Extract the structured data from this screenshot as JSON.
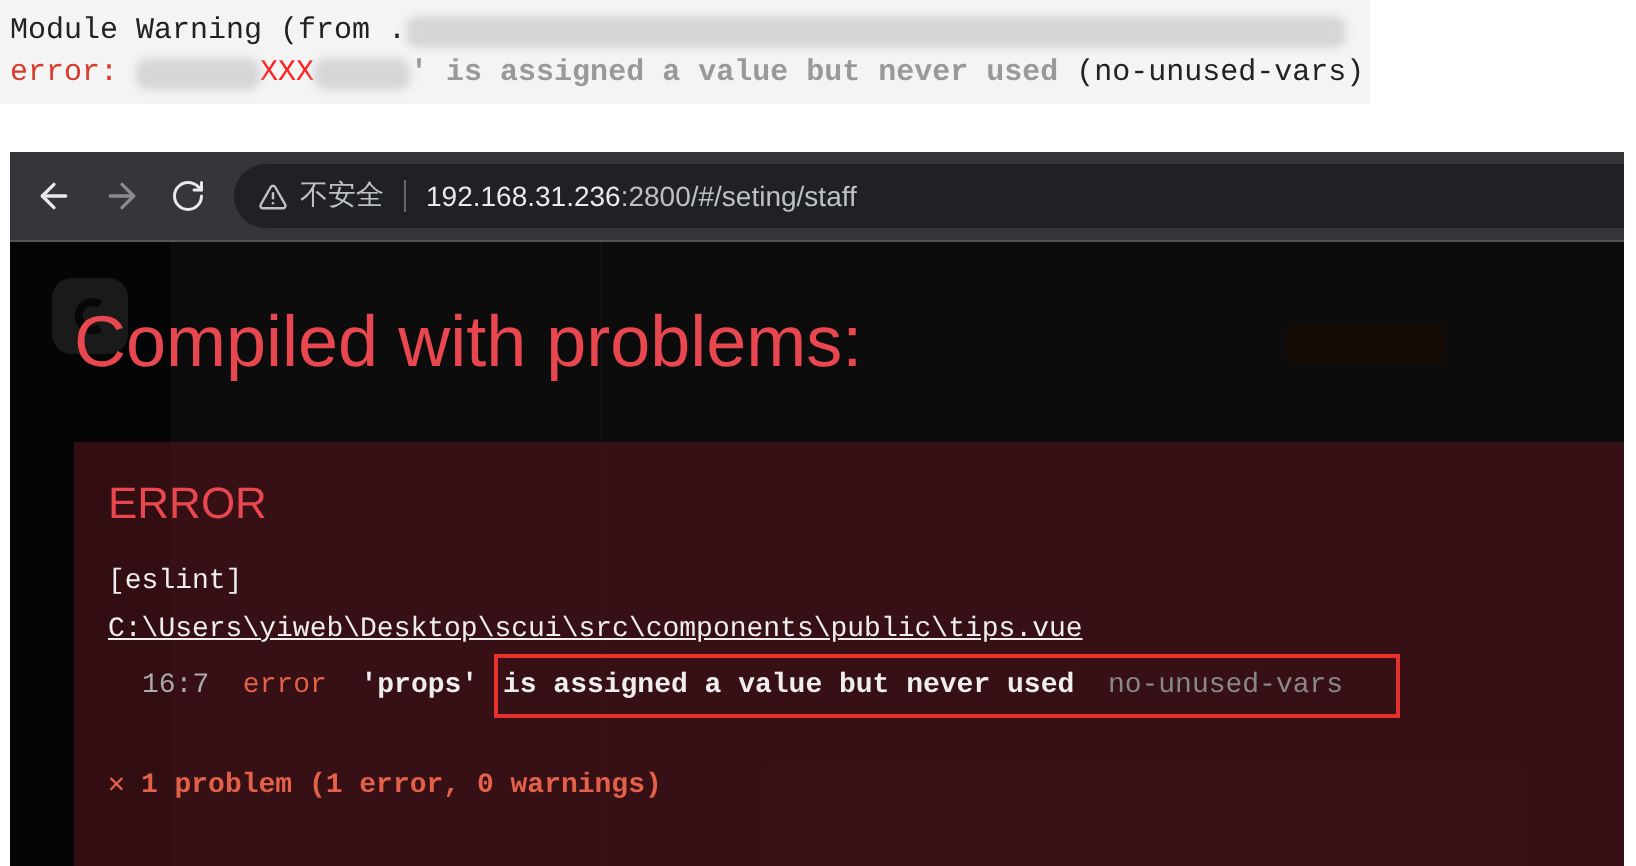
{
  "log_snippet": {
    "warning": {
      "prefix": "Module Warning (from ."
    },
    "error": {
      "label": "error:",
      "name": "XXX",
      "message": "' is assigned a value but never used",
      "rule": "(no-unused-vars)"
    }
  },
  "browser": {
    "security": "不安全",
    "host": "192.168.31.236",
    "path": ":2800/#/seting/staff"
  },
  "overlay": {
    "title": "Compiled with problems:",
    "level": "ERROR",
    "source": "[eslint]",
    "file": "C:\\Users\\yiweb\\Desktop\\scui\\src\\components\\public\\tips.vue",
    "problem": {
      "position": "16:7",
      "severity": "error",
      "name": "'props'",
      "message": "is assigned a value but never used",
      "rule": "no-unused-vars",
      "highlighted": true
    },
    "summary_icon": "✕",
    "summary": "1 problem (1 error, 0 warnings)"
  }
}
